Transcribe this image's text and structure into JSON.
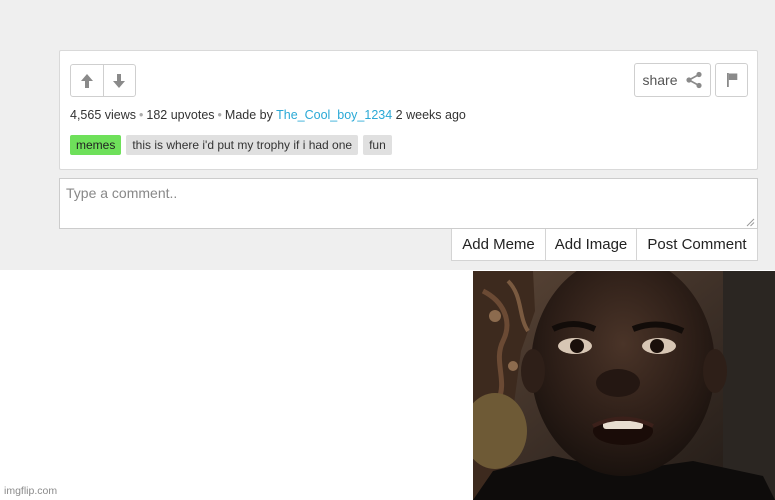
{
  "post": {
    "views": "4,565 views",
    "upvotes": "182 upvotes",
    "made_by_prefix": "Made by",
    "author": "The_Cool_boy_1234",
    "time_ago": "2 weeks ago",
    "separator": "•",
    "tags": [
      "memes",
      "this is where i'd put my trophy if i had one",
      "fun"
    ],
    "share_label": "share",
    "icons": {
      "upvote": "arrow-up-icon",
      "downvote": "arrow-down-icon",
      "share": "share-icon",
      "flag": "flag-icon"
    }
  },
  "comment": {
    "placeholder": "Type a comment..",
    "value": ""
  },
  "actions": {
    "add_meme": "Add Meme",
    "add_image": "Add Image",
    "post_comment": "Post Comment"
  },
  "watermark": "imgflip.com",
  "colors": {
    "author_link": "#2aa9d6",
    "active_tag": "#6ee05a",
    "tag_bg": "#e0e0e0",
    "page_bg": "#efefef"
  }
}
